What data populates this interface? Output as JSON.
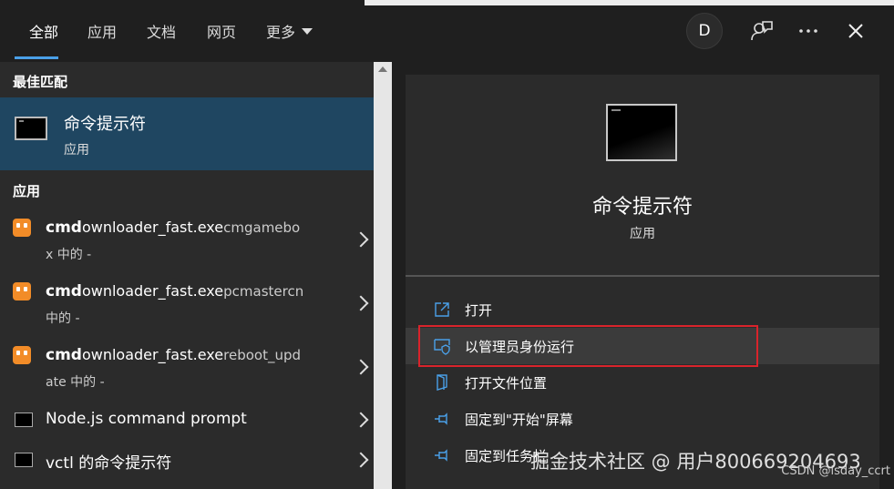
{
  "tabs": [
    "全部",
    "应用",
    "文档",
    "网页",
    "更多"
  ],
  "avatar_letter": "D",
  "icons": {
    "feedback": "feedback-icon",
    "more": "more-options-icon",
    "close": "close-icon"
  },
  "left": {
    "best_match_header": "最佳匹配",
    "best_match": {
      "title": "命令提示符",
      "subtitle": "应用"
    },
    "apps_header": "应用",
    "items": [
      {
        "bold": "cmd",
        "rest": "ownloader_fast.exe",
        "loc": "cmgamebo",
        "line2": "x 中的 -"
      },
      {
        "bold": "cmd",
        "rest": "ownloader_fast.exe",
        "loc": "pcmastercn",
        "line2": "中的 -"
      },
      {
        "bold": "cmd",
        "rest": "ownloader_fast.exe",
        "loc": "reboot_upd",
        "line2": "ate 中的 -"
      },
      {
        "text": "Node.js command prompt"
      },
      {
        "text": "vctl 的命令提示符"
      }
    ]
  },
  "right": {
    "title": "命令提示符",
    "subtitle": "应用",
    "actions": [
      "打开",
      "以管理员身份运行",
      "打开文件位置",
      "固定到\"开始\"屏幕",
      "固定到任务栏"
    ]
  },
  "watermark": "掘金技术社区 @ 用户800669204693",
  "watermark2": "CSDN @isday_ccrt",
  "colors": {
    "accent": "#4aa0e8",
    "selection": "#1f4661",
    "highlight_border": "#d9232b"
  }
}
